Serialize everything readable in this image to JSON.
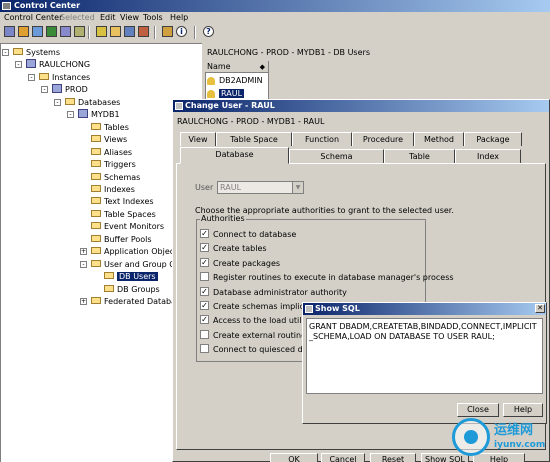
{
  "window": {
    "title": "Control Center"
  },
  "menubar": [
    {
      "label": "Control Center",
      "disabled": false
    },
    {
      "label": "Selected",
      "disabled": true
    },
    {
      "label": "Edit",
      "disabled": false
    },
    {
      "label": "View",
      "disabled": false
    },
    {
      "label": "Tools",
      "disabled": false
    },
    {
      "label": "Help",
      "disabled": false
    }
  ],
  "toolbar": {
    "icons": [
      "control-center-icon",
      "replication-icon",
      "satellite-icon",
      "command-center-icon",
      "task-center-icon",
      "journal-icon",
      "license-icon",
      "dev-center-icon",
      "health-center-icon",
      "configuration-icon",
      "contacts-icon",
      "info-icon",
      "help-icon"
    ]
  },
  "tree": [
    {
      "label": "Systems",
      "indent": 0,
      "expander": "-",
      "icon": "folder"
    },
    {
      "label": "RAULCHONG",
      "indent": 1,
      "expander": "-",
      "icon": "system"
    },
    {
      "label": "Instances",
      "indent": 2,
      "expander": "-",
      "icon": "folder"
    },
    {
      "label": "PROD",
      "indent": 3,
      "expander": "-",
      "icon": "system"
    },
    {
      "label": "Databases",
      "indent": 4,
      "expander": "-",
      "icon": "folder"
    },
    {
      "label": "MYDB1",
      "indent": 5,
      "expander": "-",
      "icon": "system"
    },
    {
      "label": "Tables",
      "indent": 6,
      "expander": "",
      "icon": "folder"
    },
    {
      "label": "Views",
      "indent": 6,
      "expander": "",
      "icon": "folder"
    },
    {
      "label": "Aliases",
      "indent": 6,
      "expander": "",
      "icon": "folder"
    },
    {
      "label": "Triggers",
      "indent": 6,
      "expander": "",
      "icon": "folder"
    },
    {
      "label": "Schemas",
      "indent": 6,
      "expander": "",
      "icon": "folder"
    },
    {
      "label": "Indexes",
      "indent": 6,
      "expander": "",
      "icon": "folder"
    },
    {
      "label": "Text Indexes",
      "indent": 6,
      "expander": "",
      "icon": "folder"
    },
    {
      "label": "Table Spaces",
      "indent": 6,
      "expander": "",
      "icon": "folder"
    },
    {
      "label": "Event Monitors",
      "indent": 6,
      "expander": "",
      "icon": "folder"
    },
    {
      "label": "Buffer Pools",
      "indent": 6,
      "expander": "",
      "icon": "folder"
    },
    {
      "label": "Application Objects",
      "indent": 6,
      "expander": "+",
      "icon": "folder"
    },
    {
      "label": "User and Group Objects",
      "indent": 6,
      "expander": "-",
      "icon": "folder"
    },
    {
      "label": "DB Users",
      "indent": 7,
      "expander": "",
      "icon": "folder",
      "selected": true
    },
    {
      "label": "DB Groups",
      "indent": 7,
      "expander": "",
      "icon": "folder"
    },
    {
      "label": "Federated Database Ob",
      "indent": 6,
      "expander": "+",
      "icon": "folder"
    }
  ],
  "right_panel": {
    "header": "RAULCHONG - PROD - MYDB1 - DB Users",
    "column_name": "Name",
    "users": [
      {
        "name": "DB2ADMIN",
        "selected": false
      },
      {
        "name": "RAUL",
        "selected": true
      }
    ]
  },
  "change_user_dialog": {
    "title": "Change User - RAUL",
    "path": "RAULCHONG - PROD - MYDB1 - RAUL",
    "tabs_row1": [
      "View",
      "Table Space",
      "Function",
      "Procedure",
      "Method",
      "Package"
    ],
    "tabs_row2": [
      "Database",
      "Schema",
      "Table",
      "Index"
    ],
    "active_tab": "Database",
    "user_label": "User",
    "user_value": "RAUL",
    "instructions": "Choose the appropriate authorities to grant to the selected user.",
    "authorities_label": "Authorities",
    "authorities": [
      {
        "label": "Connect to database",
        "checked": true
      },
      {
        "label": "Create tables",
        "checked": true
      },
      {
        "label": "Create packages",
        "checked": true
      },
      {
        "label": "Register routines to execute in database manager's process",
        "checked": false
      },
      {
        "label": "Database administrator authority",
        "checked": true
      },
      {
        "label": "Create schemas implicitly",
        "checked": true
      },
      {
        "label": "Access to the load utility",
        "checked": true
      },
      {
        "label": "Create external routines",
        "checked": false
      },
      {
        "label": "Connect to quiesced database",
        "checked": false
      }
    ],
    "buttons": [
      "OK",
      "Cancel",
      "Reset",
      "Show SQL",
      "Help"
    ]
  },
  "show_sql_dialog": {
    "title": "Show SQL",
    "sql": "GRANT DBADM,CREATETAB,BINDADD,CONNECT,IMPLICIT_SCHEMA,LOAD ON DATABASE  TO USER RAUL;",
    "close_label": "Close",
    "help_label": "Help"
  },
  "watermark": {
    "text_cn": "运维网",
    "url": "iyunv.com"
  },
  "colors": {
    "title_active": "#0a246a",
    "face": "#d4d0c8",
    "watermark": "#1f9ad8"
  }
}
